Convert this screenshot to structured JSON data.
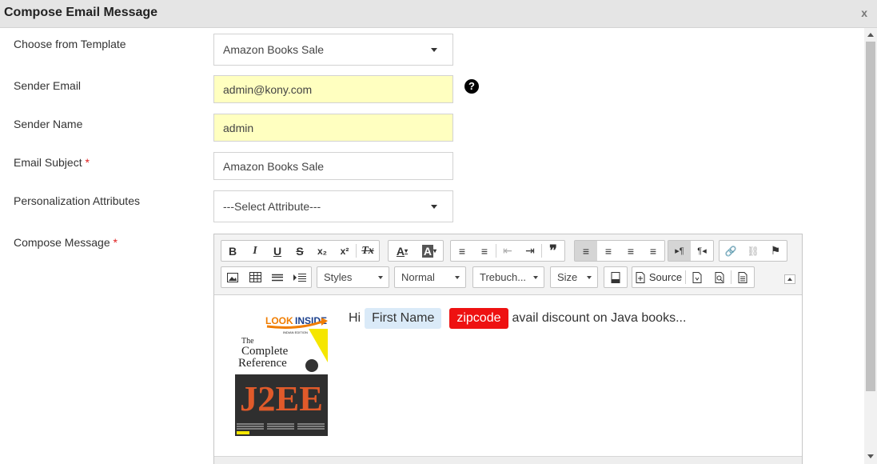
{
  "dialog": {
    "title": "Compose Email Message",
    "close": "x"
  },
  "form": {
    "template_label": "Choose from Template",
    "template_value": "Amazon Books Sale",
    "sender_email_label": "Sender Email",
    "sender_email_value": "admin@kony.com",
    "sender_name_label": "Sender Name",
    "sender_name_value": "admin",
    "subject_label": "Email Subject",
    "subject_value": "Amazon Books Sale",
    "attr_label": "Personalization Attributes",
    "attr_value": "---Select Attribute---",
    "compose_label": "Compose Message",
    "required_mark": "*",
    "help_glyph": "?"
  },
  "toolbar": {
    "row1": [
      {
        "name": "bold",
        "glyph": "B"
      },
      {
        "name": "italic",
        "glyph": "I"
      },
      {
        "name": "underline",
        "glyph": "U"
      },
      {
        "name": "strike",
        "glyph": "S"
      },
      {
        "name": "subscript",
        "glyph": "x₂"
      },
      {
        "name": "superscript",
        "glyph": "x²"
      },
      {
        "name": "remove-format",
        "glyph": "Tx"
      }
    ],
    "text_color": "A",
    "bg_color": "A",
    "row1b": [
      {
        "name": "numbered-list",
        "glyph": "≡"
      },
      {
        "name": "bulleted-list",
        "glyph": "≡"
      },
      {
        "name": "outdent",
        "glyph": "⇤"
      },
      {
        "name": "indent",
        "glyph": "⇥"
      },
      {
        "name": "blockquote",
        "glyph": "❞"
      }
    ],
    "row1c": [
      {
        "name": "align-left",
        "glyph": "≡"
      },
      {
        "name": "align-center",
        "glyph": "≡"
      },
      {
        "name": "align-right",
        "glyph": "≡"
      },
      {
        "name": "justify",
        "glyph": "≡"
      }
    ],
    "dir": [
      {
        "name": "ltr",
        "glyph": "▸¶"
      },
      {
        "name": "rtl",
        "glyph": "¶◂"
      }
    ],
    "links": [
      {
        "name": "link",
        "glyph": "🔗"
      },
      {
        "name": "unlink",
        "glyph": "⛓"
      },
      {
        "name": "anchor",
        "glyph": "⚑"
      }
    ],
    "styles_label": "Styles",
    "format_label": "Normal",
    "font_label": "Trebuch...",
    "size_label": "Size",
    "source_label": "Source"
  },
  "message": {
    "greeting": "Hi",
    "first_name_chip": "First Name",
    "zip_chip": "zipcode",
    "rest": "avail discount on Java books...",
    "book": {
      "banner": "LOOK INSIDE!",
      "edition": "INDIAN EDITION",
      "line1": "The",
      "line2": "Complete",
      "line3": "Reference",
      "big": "J2EE"
    }
  },
  "colors": {
    "required": "#e02020",
    "zip_chip": "#ee1111",
    "name_chip": "#daeaf8",
    "prefilled": "#ffffc0"
  }
}
